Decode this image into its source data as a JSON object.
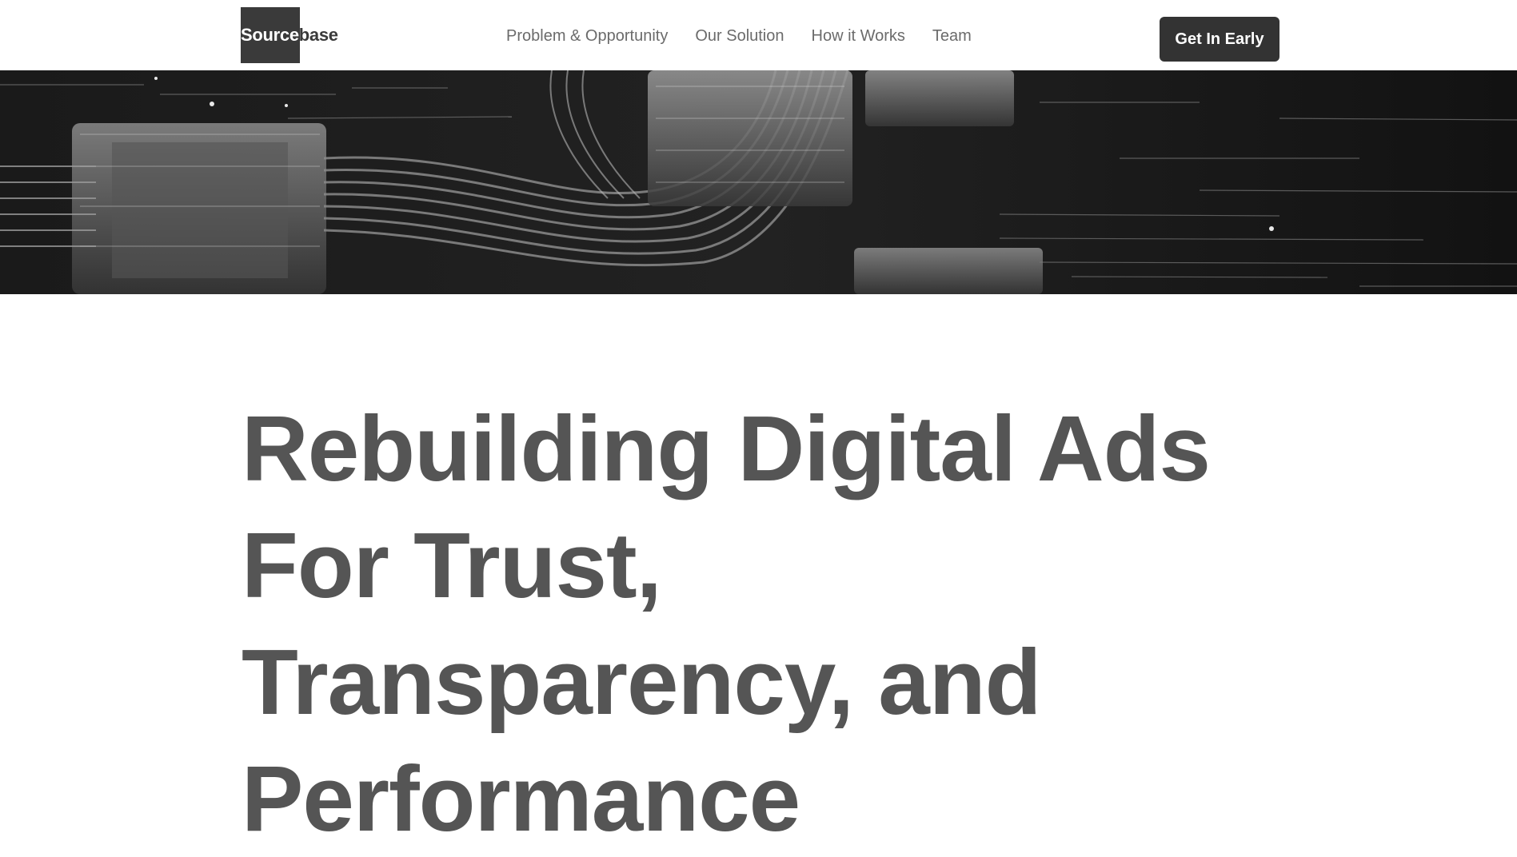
{
  "brand": {
    "name_part1": "Source",
    "name_part2": "base"
  },
  "nav": {
    "items": [
      {
        "label": "Problem & Opportunity"
      },
      {
        "label": "Our Solution"
      },
      {
        "label": "How it Works"
      },
      {
        "label": "Team"
      }
    ]
  },
  "cta": {
    "label": "Get In Early"
  },
  "banner": {
    "icon": "abstract-data-cables-image"
  },
  "hero": {
    "title": "Rebuilding Digital Ads For Trust, Transparency, and Performance"
  },
  "colors": {
    "logo_box": "#3a3a3a",
    "cta_bg": "#333333",
    "nav_text": "#6b6b6b",
    "hero_text": "#555555",
    "banner_bg": "#141414"
  }
}
